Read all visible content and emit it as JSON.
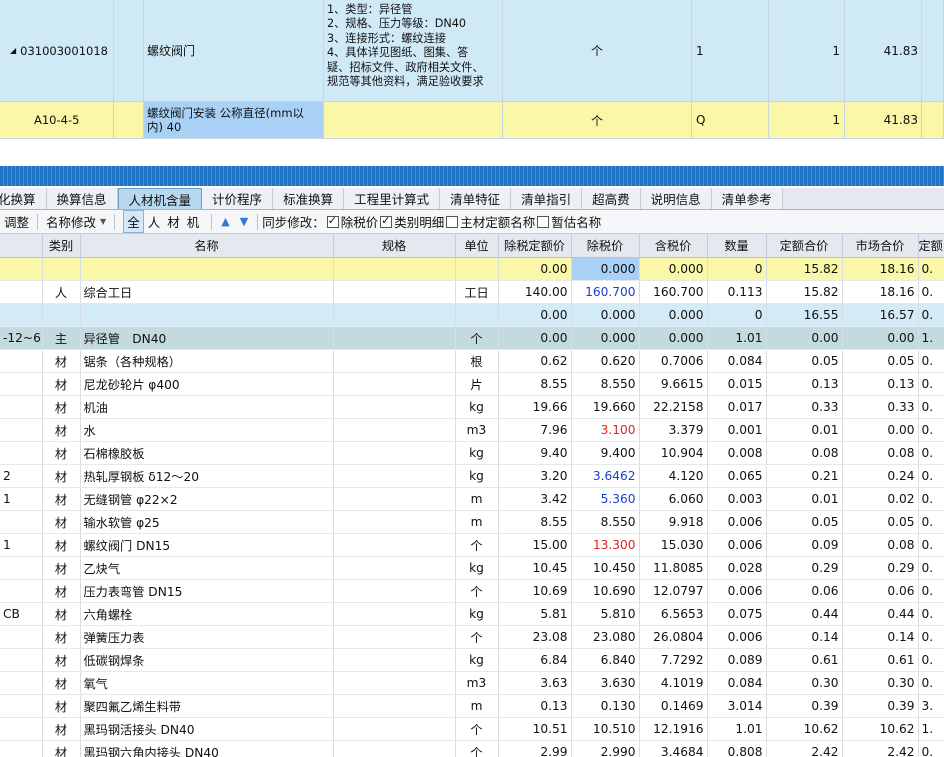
{
  "upper": {
    "row1": {
      "code": "031003001018",
      "name": "螺纹阀门",
      "feature_lines": [
        "1、类型：异径管",
        "2、规格、压力等级：DN40",
        "3、连接形式：螺纹连接",
        "4、具体详见图纸、图集、答",
        "疑、招标文件、政府相关文件、",
        "规范等其他资料，满足验收要求"
      ],
      "unit": "个",
      "expr": "1",
      "qty": "1",
      "price": "41.83"
    },
    "row2": {
      "code": "A10-4-5",
      "name": "螺纹阀门安装 公称直径(mm以内) 40",
      "unit": "个",
      "expr": "Q",
      "qty": "1",
      "price": "41.83"
    }
  },
  "tabs": [
    "化换算",
    "换算信息",
    "人材机含量",
    "计价程序",
    "标准换算",
    "工程里计算式",
    "清单特征",
    "清单指引",
    "超高费",
    "说明信息",
    "清单参考"
  ],
  "active_tab": "人材机含量",
  "toolbar": {
    "adjust": "调整",
    "name_modify": "名称修改",
    "filters": [
      "全",
      "人",
      "材",
      "机"
    ],
    "sync_label": "同步修改：",
    "checkboxes": [
      {
        "label": "除税价",
        "checked": true
      },
      {
        "label": "类别明细",
        "checked": true
      },
      {
        "label": "主材定额名称",
        "checked": false
      },
      {
        "label": "暂估名称",
        "checked": false
      }
    ]
  },
  "grid": {
    "headers": [
      "",
      "类别",
      "名称",
      "规格",
      "单位",
      "除税定额价",
      "除税价",
      "含税价",
      "数量",
      "定额合价",
      "市场合价",
      "定额"
    ],
    "rows": [
      {
        "style": "yellow",
        "cells": [
          "",
          "",
          "",
          "",
          "",
          "0.00",
          "0.000",
          "0.000",
          "0",
          "15.82",
          "18.16",
          "0."
        ]
      },
      {
        "style": "white",
        "cells": [
          "",
          "人",
          "综合工日",
          "",
          "工日",
          "140.00",
          "160.700",
          "160.700",
          "0.113",
          "15.82",
          "18.16",
          "0."
        ],
        "price_color": "blue"
      },
      {
        "style": "blue",
        "cells": [
          "",
          "",
          "",
          "",
          "",
          "0.00",
          "0.000",
          "0.000",
          "0",
          "16.55",
          "16.57",
          "0."
        ]
      },
      {
        "style": "teal",
        "cells": [
          "-12~6",
          "主",
          "异径管　DN40",
          "",
          "个",
          "0.00",
          "0.000",
          "0.000",
          "1.01",
          "0.00",
          "0.00",
          "1."
        ]
      },
      {
        "style": "white",
        "cells": [
          "",
          "材",
          "锯条（各种规格）",
          "",
          "根",
          "0.62",
          "0.620",
          "0.7006",
          "0.084",
          "0.05",
          "0.05",
          "0."
        ]
      },
      {
        "style": "white",
        "cells": [
          "",
          "材",
          "尼龙砂轮片 φ400",
          "",
          "片",
          "8.55",
          "8.550",
          "9.6615",
          "0.015",
          "0.13",
          "0.13",
          "0."
        ]
      },
      {
        "style": "white",
        "cells": [
          "",
          "材",
          "机油",
          "",
          "kg",
          "19.66",
          "19.660",
          "22.2158",
          "0.017",
          "0.33",
          "0.33",
          "0."
        ]
      },
      {
        "style": "white",
        "cells": [
          "",
          "材",
          "水",
          "",
          "m3",
          "7.96",
          "3.100",
          "3.379",
          "0.001",
          "0.01",
          "0.00",
          "0."
        ],
        "price_color": "red"
      },
      {
        "style": "white",
        "cells": [
          "",
          "材",
          "石棉橡胶板",
          "",
          "kg",
          "9.40",
          "9.400",
          "10.904",
          "0.008",
          "0.08",
          "0.08",
          "0."
        ]
      },
      {
        "style": "white",
        "cells": [
          "2",
          "材",
          "热轧厚钢板 δ12～20",
          "",
          "kg",
          "3.20",
          "3.6462",
          "4.120",
          "0.065",
          "0.21",
          "0.24",
          "0."
        ],
        "price_color": "blue"
      },
      {
        "style": "white",
        "cells": [
          "1",
          "材",
          "无缝钢管 φ22×2",
          "",
          "m",
          "3.42",
          "5.360",
          "6.060",
          "0.003",
          "0.01",
          "0.02",
          "0."
        ],
        "price_color": "blue"
      },
      {
        "style": "white",
        "cells": [
          "",
          "材",
          "输水软管 φ25",
          "",
          "m",
          "8.55",
          "8.550",
          "9.918",
          "0.006",
          "0.05",
          "0.05",
          "0."
        ]
      },
      {
        "style": "white",
        "cells": [
          "1",
          "材",
          "螺纹阀门 DN15",
          "",
          "个",
          "15.00",
          "13.300",
          "15.030",
          "0.006",
          "0.09",
          "0.08",
          "0."
        ],
        "price_color": "red"
      },
      {
        "style": "white",
        "cells": [
          "",
          "材",
          "乙炔气",
          "",
          "kg",
          "10.45",
          "10.450",
          "11.8085",
          "0.028",
          "0.29",
          "0.29",
          "0."
        ]
      },
      {
        "style": "white",
        "cells": [
          "",
          "材",
          "压力表弯管 DN15",
          "",
          "个",
          "10.69",
          "10.690",
          "12.0797",
          "0.006",
          "0.06",
          "0.06",
          "0."
        ]
      },
      {
        "style": "white",
        "cells": [
          "CB",
          "材",
          "六角螺栓",
          "",
          "kg",
          "5.81",
          "5.810",
          "6.5653",
          "0.075",
          "0.44",
          "0.44",
          "0."
        ]
      },
      {
        "style": "white",
        "cells": [
          "",
          "材",
          "弹簧压力表",
          "",
          "个",
          "23.08",
          "23.080",
          "26.0804",
          "0.006",
          "0.14",
          "0.14",
          "0."
        ]
      },
      {
        "style": "white",
        "cells": [
          "",
          "材",
          "低碳钢焊条",
          "",
          "kg",
          "6.84",
          "6.840",
          "7.7292",
          "0.089",
          "0.61",
          "0.61",
          "0."
        ]
      },
      {
        "style": "white",
        "cells": [
          "",
          "材",
          "氧气",
          "",
          "m3",
          "3.63",
          "3.630",
          "4.1019",
          "0.084",
          "0.30",
          "0.30",
          "0."
        ]
      },
      {
        "style": "white",
        "cells": [
          "",
          "材",
          "聚四氟乙烯生料带",
          "",
          "m",
          "0.13",
          "0.130",
          "0.1469",
          "3.014",
          "0.39",
          "0.39",
          "3."
        ]
      },
      {
        "style": "white",
        "cells": [
          "",
          "材",
          "黑玛钢活接头 DN40",
          "",
          "个",
          "10.51",
          "10.510",
          "12.1916",
          "1.01",
          "10.62",
          "10.62",
          "1."
        ]
      },
      {
        "style": "white",
        "cells": [
          "",
          "材",
          "黑玛钢六角内接头 DN40",
          "",
          "个",
          "2.99",
          "2.990",
          "3.4684",
          "0.808",
          "2.42",
          "2.42",
          "0."
        ]
      }
    ]
  },
  "colors": {
    "price_red": "#e02020",
    "price_blue": "#1a3fd0",
    "highlight_yellow": "#fbf7a8",
    "row_blue": "#d3ebf7"
  }
}
